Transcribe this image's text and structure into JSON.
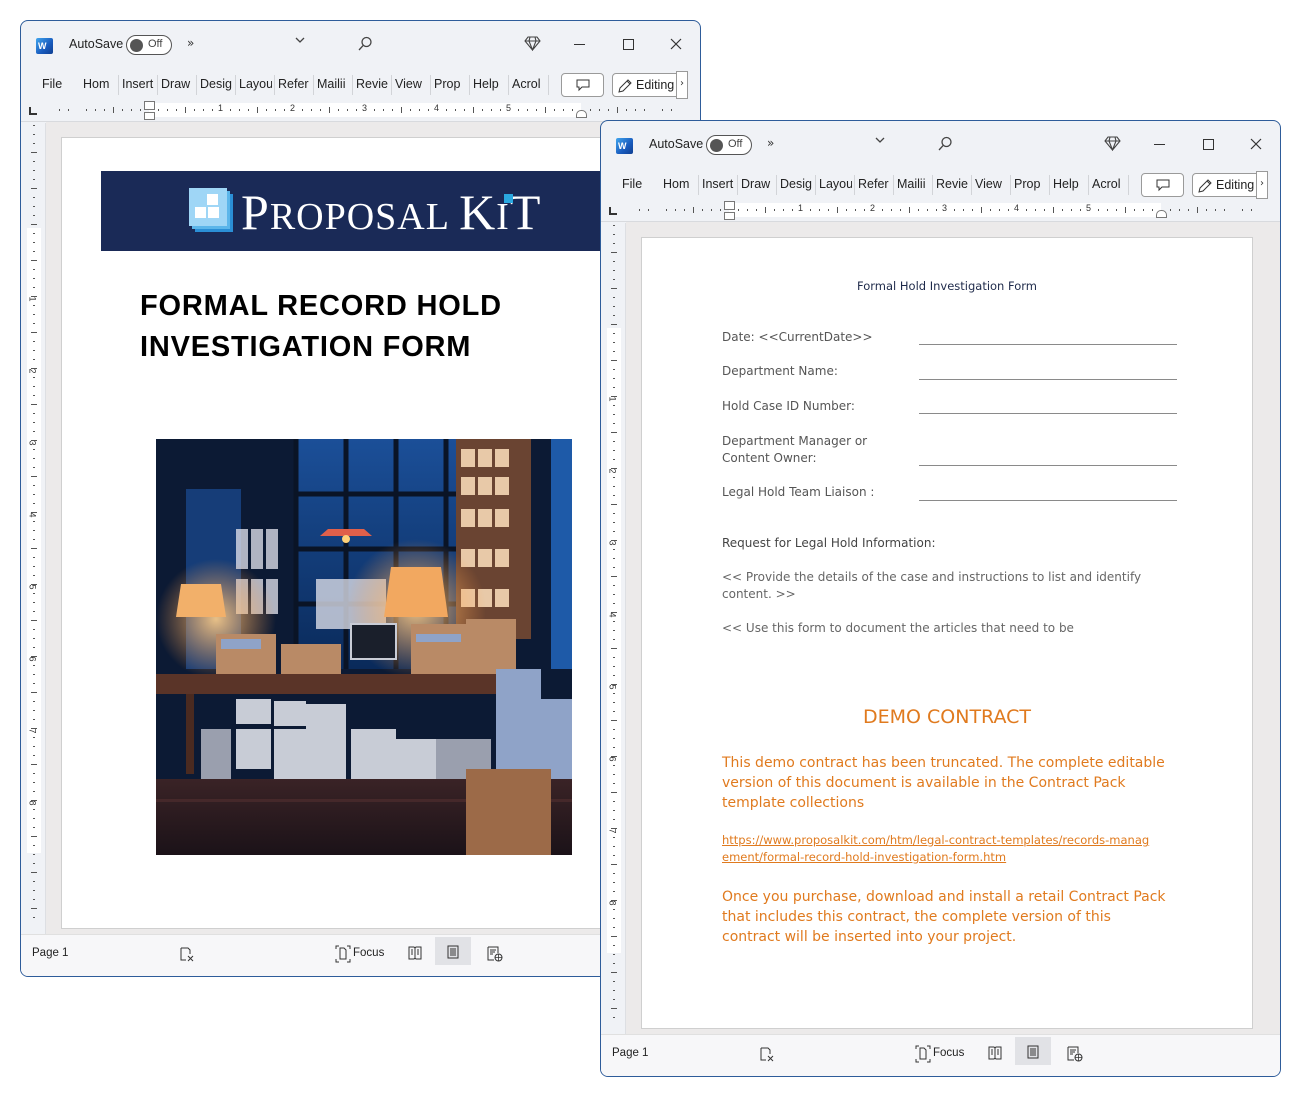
{
  "app": {
    "autosave_label": "AutoSave",
    "autosave_state": "Off",
    "more_commands": "»",
    "ribbon_tabs": [
      "File",
      "Hom",
      "Insert",
      "Draw",
      "Desig",
      "Layou",
      "Refer",
      "Mailii",
      "Revie",
      "View",
      "Prop",
      "Help",
      "Acrol"
    ],
    "editing_label": "Editing",
    "editing_more": "›",
    "ruler_numbers": [
      "1",
      "2",
      "3",
      "4",
      "5"
    ],
    "vruler_numbers": [
      "1",
      "2",
      "3",
      "4",
      "5",
      "6",
      "7",
      "8"
    ],
    "status": {
      "page": "Page 1",
      "focus_label": "Focus"
    },
    "icons": {
      "app": "word-logo-icon",
      "search": "search-icon",
      "premium": "diamond-icon",
      "minimize": "minimize-icon",
      "maximize": "maximize-icon",
      "close": "close-icon",
      "comments": "comment-icon",
      "editing": "pencil-icon",
      "accessibility": "accessibility-check-icon",
      "focus": "focus-icon",
      "read_mode": "read-mode-icon",
      "print_layout": "print-layout-icon",
      "web_layout": "web-layout-icon"
    }
  },
  "left_window": {
    "logo_text_big_p": "P",
    "logo_text_rest1": "ROPOSAL ",
    "logo_text_big_k": "K",
    "logo_text_i": "I",
    "logo_text_big_t": "T",
    "cover_title": "FORMAL RECORD HOLD INVESTIGATION FORM",
    "cover_image_alt": "Office desk at night piled with stacked papers, file boxes and lamps"
  },
  "right_window": {
    "doc_title": "Formal Hold Investigation Form",
    "fields": [
      {
        "label": "Date: <<CurrentDate>>"
      },
      {
        "label": "Department Name:"
      },
      {
        "label": "Hold Case ID Number:"
      },
      {
        "label": "Department Manager or Content Owner:"
      },
      {
        "label": "Legal Hold Team Liaison :"
      }
    ],
    "section_head": "Request for Legal Hold Information:",
    "para1": "<< Provide the details of the case and instructions to list and identify content. >>",
    "para2": "<< Use this form to document the articles that need to be",
    "demo_head": "DEMO CONTRACT",
    "demo_para1": "This demo contract has been truncated. The complete editable version of this document is available in the Contract Pack template collections",
    "demo_link": "https://www.proposalkit.com/htm/legal-contract-templates/records-management/formal-record-hold-investigation-form.htm",
    "demo_para2": "Once you purchase, download and install a retail Contract Pack that includes this contract, the complete version of this contract will be inserted into your project."
  },
  "colors": {
    "demo_orange": "#e07a1e",
    "banner_navy": "#1a2a57",
    "window_border": "#2e5c9a"
  }
}
